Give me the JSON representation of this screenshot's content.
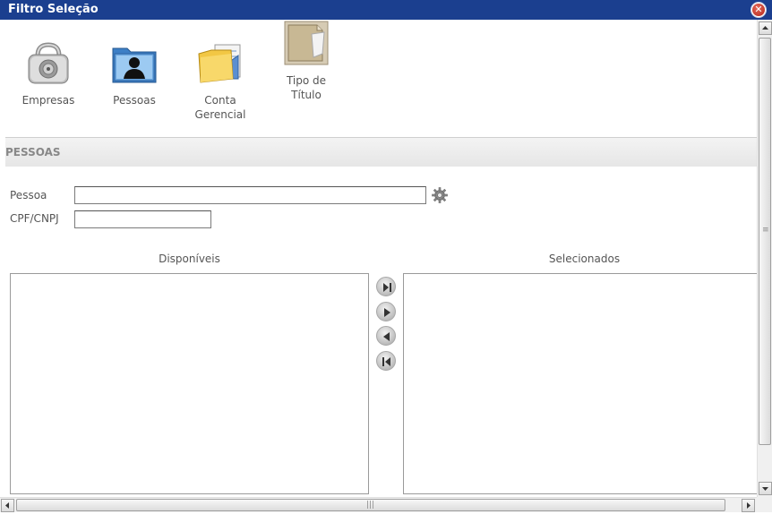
{
  "window": {
    "title": "Filtro Seleção"
  },
  "toolbar": {
    "items": [
      {
        "label": "Empresas",
        "icon": "safe-lock-icon"
      },
      {
        "label": "Pessoas",
        "icon": "person-folder-icon"
      },
      {
        "label": "Conta\nGerencial",
        "icon": "folder-accounts-icon"
      },
      {
        "label": "Tipo de\nTítulo",
        "icon": "document-folder-icon"
      }
    ]
  },
  "section": {
    "title": "PESSOAS"
  },
  "form": {
    "pessoa_label": "Pessoa",
    "pessoa_value": "",
    "cpf_label": "CPF/CNPJ",
    "cpf_value": ""
  },
  "lists": {
    "available_title": "Disponíveis",
    "selected_title": "Selecionados",
    "available_items": [],
    "selected_items": []
  },
  "colors": {
    "titlebar": "#1b3f8f",
    "section_bar": "#e9e9e9"
  }
}
